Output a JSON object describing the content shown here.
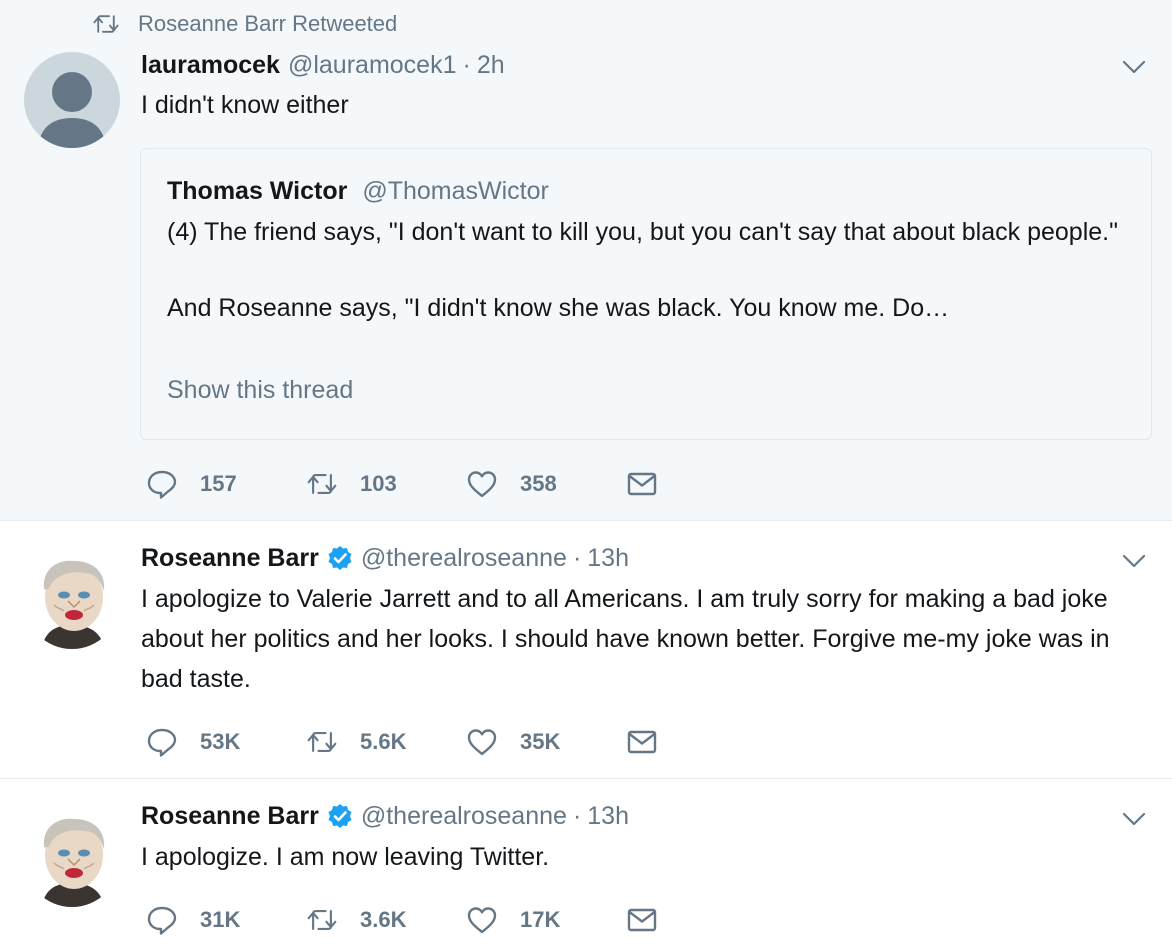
{
  "colors": {
    "secondary": "#657786",
    "verified": "#1da1f2",
    "border": "#e6ecf0",
    "highlight_bg": "#f5f8fa"
  },
  "icons": {
    "retweet": "retweet-icon",
    "reply": "reply-icon",
    "like": "heart-icon",
    "dm": "envelope-icon",
    "verified": "verified-badge-icon",
    "caret": "chevron-down-icon"
  },
  "tweets": [
    {
      "retweet_context": "Roseanne Barr Retweeted",
      "name": "lauramocek",
      "handle": "@lauramocek1",
      "sep": "·",
      "time": "2h",
      "text": "I didn't know either",
      "quote": {
        "name": "Thomas Wictor",
        "handle": "@ThomasWictor",
        "text_line1": "(4) The friend says, \"I don't want to kill you, but you can't say that about black people.\"",
        "text_line2": "And Roseanne says, \"I didn't know she was black. You know me. Do…",
        "more": "Show this thread"
      },
      "replies": "157",
      "retweets": "103",
      "likes": "358"
    },
    {
      "name": "Roseanne Barr",
      "handle": "@therealroseanne",
      "sep": "·",
      "time": "13h",
      "text": "I apologize to Valerie Jarrett and to all Americans. I am truly sorry for making a bad joke about her politics and her looks. I should have known better. Forgive me-my joke was in bad taste.",
      "replies": "53K",
      "retweets": "5.6K",
      "likes": "35K"
    },
    {
      "name": "Roseanne Barr",
      "handle": "@therealroseanne",
      "sep": "·",
      "time": "13h",
      "text": "I apologize. I am now leaving Twitter.",
      "replies": "31K",
      "retweets": "3.6K",
      "likes": "17K"
    }
  ]
}
